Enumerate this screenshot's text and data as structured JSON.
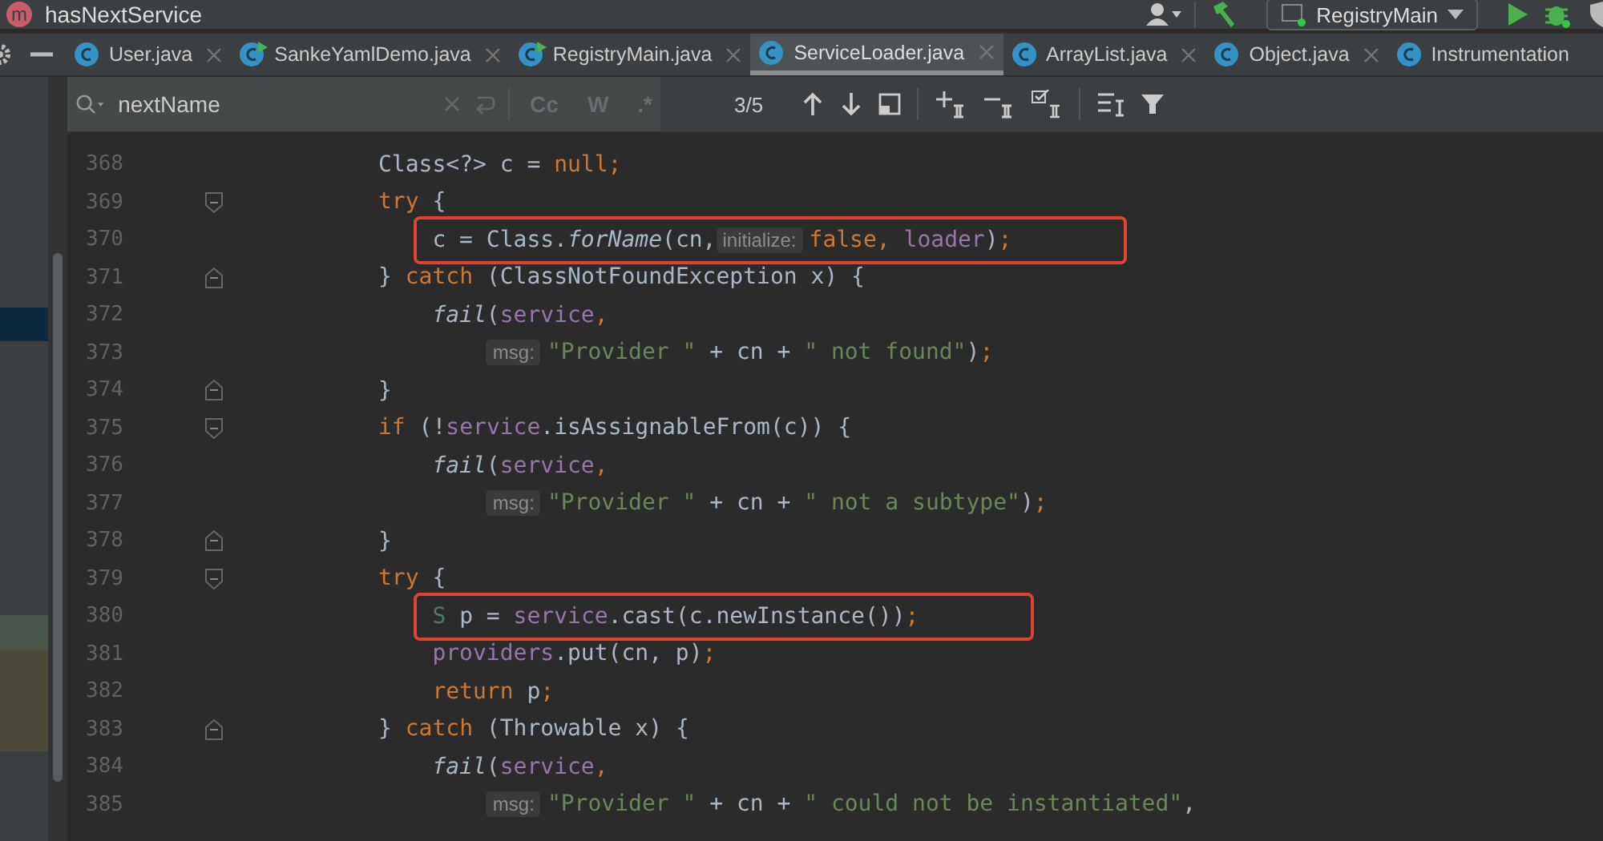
{
  "title_bar": {
    "avatar": "m",
    "title": "hasNextService",
    "run_config": "RegistryMain"
  },
  "tabs": [
    {
      "label": "User.java",
      "selected": false,
      "runnable": false
    },
    {
      "label": "SankeYamlDemo.java",
      "selected": false,
      "runnable": true
    },
    {
      "label": "RegistryMain.java",
      "selected": false,
      "runnable": true
    },
    {
      "label": "ServiceLoader.java",
      "selected": true,
      "runnable": false
    },
    {
      "label": "ArrayList.java",
      "selected": false,
      "runnable": false
    },
    {
      "label": "Object.java",
      "selected": false,
      "runnable": false
    },
    {
      "label": "Instrumentation",
      "selected": false,
      "runnable": false
    }
  ],
  "search": {
    "value": "nextName",
    "match_case": "Cc",
    "words": "W",
    "regex": ".*",
    "count": "3/5"
  },
  "code_lines": [
    {
      "number": "368",
      "highlighted": false,
      "tokens": [
        {
          "kind": "plain",
          "t": "Class<?> c = "
        },
        {
          "kind": "kw",
          "t": "null;"
        }
      ]
    },
    {
      "number": "369",
      "kind": "fold_start",
      "highlighted": false,
      "tokens": [
        {
          "kind": "kw",
          "t": "try"
        },
        {
          "kind": "plain",
          "t": " {"
        }
      ],
      "children": [
        {
          "number": "370",
          "highlighted": true,
          "tokens": [
            {
              "kind": "plain",
              "t": "c = Class."
            },
            {
              "kind": "italic",
              "t": "forName"
            },
            {
              "kind": "plain",
              "t": "(cn, "
            },
            {
              "kind": "hint",
              "t": "initialize:"
            },
            {
              "kind": "kw",
              "t": "false, "
            },
            {
              "kind": "field",
              "t": "loader"
            },
            {
              "kind": "plain",
              "t": ")"
            },
            {
              "kind": "kw",
              "t": ";"
            }
          ]
        }
      ]
    },
    {
      "number": "371",
      "kind": "fold_end",
      "highlighted": false,
      "tokens": [
        {
          "kind": "plain",
          "t": "} "
        },
        {
          "kind": "kw",
          "t": "catch"
        },
        {
          "kind": "plain",
          "t": " (ClassNotFoundException x) {"
        }
      ],
      "children": [
        {
          "number": "372",
          "highlighted": false,
          "tokens": [
            {
              "kind": "italic",
              "t": "fail"
            },
            {
              "kind": "plain",
              "t": "("
            },
            {
              "kind": "field",
              "t": "service"
            },
            {
              "kind": "kw",
              "t": ","
            }
          ],
          "children": [
            {
              "number": "373",
              "highlighted": false,
              "tokens": [
                {
                  "kind": "hint",
                  "t": "msg:"
                },
                {
                  "kind": "str",
                  "t": "\"Provider \""
                },
                {
                  "kind": "plain",
                  "t": " + cn + "
                },
                {
                  "kind": "str",
                  "t": "\" not found\""
                },
                {
                  "kind": "plain",
                  "t": ")"
                },
                {
                  "kind": "kw",
                  "t": ";"
                }
              ]
            }
          ]
        }
      ]
    },
    {
      "number": "374",
      "kind": "fold_end",
      "highlighted": false,
      "tokens": [
        {
          "kind": "plain",
          "t": "}"
        }
      ]
    },
    {
      "number": "375",
      "kind": "fold_start",
      "highlighted": false,
      "tokens": [
        {
          "kind": "kw",
          "t": "if"
        },
        {
          "kind": "plain",
          "t": " (!"
        },
        {
          "kind": "field",
          "t": "service"
        },
        {
          "kind": "plain",
          "t": ".isAssignableFrom(c)) {"
        }
      ],
      "children": [
        {
          "number": "376",
          "highlighted": false,
          "tokens": [
            {
              "kind": "italic",
              "t": "fail"
            },
            {
              "kind": "plain",
              "t": "("
            },
            {
              "kind": "field",
              "t": "service"
            },
            {
              "kind": "kw",
              "t": ","
            }
          ],
          "children": [
            {
              "number": "377",
              "highlighted": false,
              "tokens": [
                {
                  "kind": "hint",
                  "t": "msg:"
                },
                {
                  "kind": "str",
                  "t": "\"Provider \""
                },
                {
                  "kind": "plain",
                  "t": " + cn  + "
                },
                {
                  "kind": "str",
                  "t": "\" not a subtype\""
                },
                {
                  "kind": "plain",
                  "t": ")"
                },
                {
                  "kind": "kw",
                  "t": ";"
                }
              ]
            }
          ]
        }
      ]
    },
    {
      "number": "378",
      "kind": "fold_end",
      "highlighted": false,
      "tokens": [
        {
          "kind": "plain",
          "t": "}"
        }
      ]
    },
    {
      "number": "379",
      "kind": "fold_start",
      "highlighted": false,
      "tokens": [
        {
          "kind": "kw",
          "t": "try"
        },
        {
          "kind": "plain",
          "t": " {"
        }
      ],
      "children": [
        {
          "number": "380",
          "highlighted": true,
          "tokens": [
            {
              "kind": "type",
              "t": "S"
            },
            {
              "kind": "plain",
              "t": " p = "
            },
            {
              "kind": "field",
              "t": "service"
            },
            {
              "kind": "plain",
              "t": ".cast(c.newInstance())"
            },
            {
              "kind": "kw",
              "t": ";"
            }
          ]
        },
        {
          "number": "381",
          "highlighted": false,
          "tokens": [
            {
              "kind": "field",
              "t": "providers"
            },
            {
              "kind": "plain",
              "t": ".put(cn, p)"
            },
            {
              "kind": "kw",
              "t": ";"
            }
          ]
        },
        {
          "number": "382",
          "highlighted": false,
          "tokens": [
            {
              "kind": "kw",
              "t": "return"
            },
            {
              "kind": "plain",
              "t": " p"
            },
            {
              "kind": "kw",
              "t": ";"
            }
          ]
        }
      ]
    },
    {
      "number": "383",
      "kind": "fold_end",
      "highlighted": false,
      "tokens": [
        {
          "kind": "plain",
          "t": "} "
        },
        {
          "kind": "kw",
          "t": "catch"
        },
        {
          "kind": "plain",
          "t": " (Throwable x) {"
        }
      ],
      "children": [
        {
          "number": "384",
          "highlighted": false,
          "tokens": [
            {
              "kind": "italic",
              "t": "fail"
            },
            {
              "kind": "plain",
              "t": "("
            },
            {
              "kind": "field",
              "t": "service"
            },
            {
              "kind": "kw",
              "t": ","
            }
          ],
          "children": [
            {
              "number": "385",
              "highlighted": false,
              "tokens": [
                {
                  "kind": "hint",
                  "t": "msg:"
                },
                {
                  "kind": "str",
                  "t": "\"Provider \""
                },
                {
                  "kind": "plain",
                  "t": " + cn + "
                },
                {
                  "kind": "str",
                  "t": "\" could not be instantiated\""
                },
                {
                  "kind": "plain",
                  "t": ","
                }
              ]
            }
          ]
        }
      ]
    }
  ]
}
